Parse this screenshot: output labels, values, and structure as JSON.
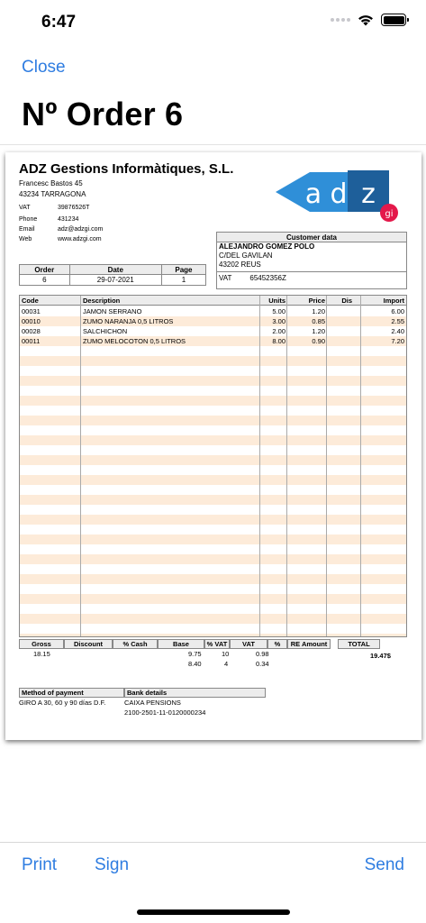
{
  "status": {
    "time": "6:47"
  },
  "nav": {
    "close_label": "Close",
    "title": "Nº Order 6"
  },
  "company": {
    "name": "ADZ Gestions Informàtiques, S.L.",
    "street": "Francesc Bastos 45",
    "city": "43234  TARRAGONA",
    "vat_key": "VAT",
    "vat": "39876526T",
    "phone_key": "Phone",
    "phone": "431234",
    "email_key": "Email",
    "email": "adz@adzgi.com",
    "web_key": "Web",
    "web": "www.adzgi.com",
    "logo_text_a": "a",
    "logo_text_d": "d",
    "logo_text_z": "z",
    "logo_text_gi": "gi",
    "logo_colors": {
      "blue": "#2f8fd8",
      "dark": "#1e5f9a",
      "red": "#e4184a"
    }
  },
  "order": {
    "headers": [
      "Order",
      "Date",
      "Page"
    ],
    "values": [
      "6",
      "29-07-2021",
      "1"
    ]
  },
  "customer": {
    "title": "Customer data",
    "name": "ALEJANDRO GOMEZ POLO",
    "street": "C/DEL GAVILAN",
    "city": "43202   REUS",
    "vat_key": "VAT",
    "vat": "65452356Z"
  },
  "items": {
    "headers": {
      "code": "Code",
      "description": "Description",
      "units": "Units",
      "price": "Price",
      "dis": "Dis",
      "import": "Import"
    },
    "rows": [
      {
        "code": "00031",
        "description": "JAMON SERRANO",
        "units": "5.00",
        "price": "1.20",
        "dis": "",
        "import": "6.00"
      },
      {
        "code": "00010",
        "description": "ZUMO NARANJA 0,5 LITROS",
        "units": "3.00",
        "price": "0.85",
        "dis": "",
        "import": "2.55"
      },
      {
        "code": "00028",
        "description": "SALCHICHON",
        "units": "2.00",
        "price": "1.20",
        "dis": "",
        "import": "2.40"
      },
      {
        "code": "00011",
        "description": "ZUMO MELOCOTON 0,5 LITROS",
        "units": "8.00",
        "price": "0.90",
        "dis": "",
        "import": "7.20"
      }
    ],
    "stripe_color": "#fdebd9"
  },
  "totals": {
    "headers": [
      "Gross",
      "Discount",
      "% Cash",
      "Base",
      "% VAT",
      "VAT",
      "%",
      "RE Amount",
      "TOTAL"
    ],
    "gross": "18.15",
    "base": [
      "9.75",
      "8.40"
    ],
    "vat_pct": [
      "10",
      "4"
    ],
    "vat": [
      "0.98",
      "0.34"
    ],
    "total": "19.47$"
  },
  "payment": {
    "method_header": "Method of payment",
    "bank_header": "Bank details",
    "method": "GIRO A 30, 60 y 90 días D.F.",
    "bank_name": "CAIXA PENSIONS",
    "bank_account": "2100-2501-11-0120000234"
  },
  "toolbar": {
    "print_label": "Print",
    "sign_label": "Sign",
    "send_label": "Send"
  },
  "colors": {
    "accent": "#2f7de1"
  }
}
